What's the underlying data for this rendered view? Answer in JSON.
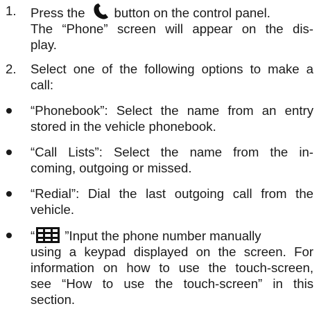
{
  "steps": [
    {
      "number": "1.",
      "line1_before": "Press the",
      "line1_after": "button on the control panel.",
      "icon": "phone-handset-icon",
      "rest": [
        "The “Phone” screen will appear on the dis-",
        "play."
      ]
    },
    {
      "number": "2.",
      "lines": [
        "Select one of the following options to make a",
        "call:"
      ]
    }
  ],
  "bullets": [
    {
      "lines": [
        "“Phonebook”: Select the name from an entry",
        "stored in the vehicle phonebook."
      ]
    },
    {
      "lines": [
        "“Call Lists”: Select the name from the in-",
        "coming, outgoing or missed."
      ]
    },
    {
      "lines": [
        "“Redial”: Dial the last outgoing call from the",
        "vehicle."
      ]
    }
  ],
  "keypad_bullet": {
    "open_quote": "“",
    "icon": "keypad-icon",
    "line1_after": " ”Input the phone number manually",
    "rest": [
      "using a keypad displayed on the screen. For",
      "information on how to use the touch-screen,",
      "see “How to use the touch-screen” in this",
      "section."
    ]
  },
  "colors": {
    "text": "#1a1a1a",
    "icon": "#111111",
    "background": "#ffffff"
  }
}
